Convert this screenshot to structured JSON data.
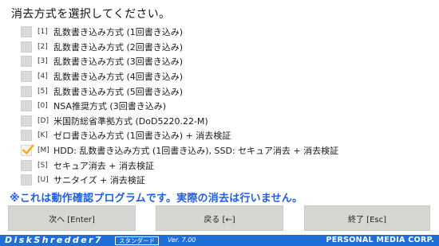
{
  "page": {
    "title": "消去方式を選択してください。",
    "notice": "※これは動作確認プログラムです。実際の消去は行いません。"
  },
  "options": [
    {
      "key": "[1]",
      "label": "乱数書き込み方式 (1回書き込み)",
      "checked": false
    },
    {
      "key": "[2]",
      "label": "乱数書き込み方式 (2回書き込み)",
      "checked": false
    },
    {
      "key": "[3]",
      "label": "乱数書き込み方式 (3回書き込み)",
      "checked": false
    },
    {
      "key": "[4]",
      "label": "乱数書き込み方式 (4回書き込み)",
      "checked": false
    },
    {
      "key": "[5]",
      "label": "乱数書き込み方式 (5回書き込み)",
      "checked": false
    },
    {
      "key": "[0]",
      "label": "NSA推奨方式 (3回書き込み)",
      "checked": false
    },
    {
      "key": "[D]",
      "label": "米国防総省準拠方式 (DoD5220.22-M)",
      "checked": false
    },
    {
      "key": "[K]",
      "label": "ゼロ書き込み方式 (1回書き込み) + 消去検証",
      "checked": false
    },
    {
      "key": "[M]",
      "label": "HDD: 乱数書き込み方式 (1回書き込み), SSD: セキュア消去 + 消去検証",
      "checked": true
    },
    {
      "key": "[S]",
      "label": "セキュア消去 + 消去検証",
      "checked": false
    },
    {
      "key": "[U]",
      "label": "サニタイズ + 消去検証",
      "checked": false
    }
  ],
  "buttons": {
    "next": "次へ [Enter]",
    "back": "戻る [←]",
    "exit": "終了 [Esc]"
  },
  "footer": {
    "product_name": "DiskShredder7",
    "edition": "スタンダード",
    "version": "Ver. 7.00",
    "company": "PERSONAL MEDIA CORP."
  },
  "colors": {
    "notice": "#1e5fe0",
    "footer_bar": "#1f6fd8",
    "checkmark": "#f2a900",
    "button_bg": "#d6d6d3"
  },
  "icons": {
    "checked_option": "checkmark-icon"
  }
}
